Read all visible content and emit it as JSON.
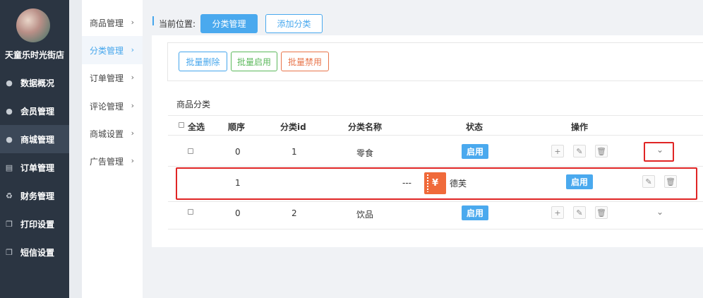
{
  "sidebar": {
    "shop_name": "天童乐时光街店",
    "items": [
      {
        "label": "数据概况",
        "icon": "user-icon"
      },
      {
        "label": "会员管理",
        "icon": "user-icon"
      },
      {
        "label": "商城管理",
        "icon": "user-icon"
      },
      {
        "label": "订单管理",
        "icon": "document-icon"
      },
      {
        "label": "财务管理",
        "icon": "recycle-icon"
      },
      {
        "label": "打印设置",
        "icon": "copy-icon"
      },
      {
        "label": "短信设置",
        "icon": "copy-icon"
      }
    ],
    "active_index": 2
  },
  "subnav": {
    "items": [
      {
        "label": "商品管理"
      },
      {
        "label": "分类管理"
      },
      {
        "label": "订单管理"
      },
      {
        "label": "评论管理"
      },
      {
        "label": "商城设置"
      },
      {
        "label": "广告管理"
      }
    ],
    "active_index": 1
  },
  "breadcrumb": {
    "label": "当前位置:",
    "current": "分类管理",
    "add_button": "添加分类"
  },
  "toolbar": {
    "bulk_delete": "批量删除",
    "bulk_enable": "批量启用",
    "bulk_disable": "批量禁用"
  },
  "table": {
    "title": "商品分类",
    "headers": {
      "select_all": "全选",
      "order": "顺序",
      "id": "分类id",
      "name": "分类名称",
      "status": "状态",
      "actions": "操作"
    },
    "rows": [
      {
        "order": "0",
        "id": "1",
        "name": "零食",
        "status": "启用"
      },
      {
        "order": "1",
        "prefix": "---",
        "name": "德芙",
        "status": "启用"
      },
      {
        "order": "0",
        "id": "2",
        "name": "饮品",
        "status": "启用"
      }
    ]
  },
  "colors": {
    "accent": "#4aa9ee",
    "sidebar_bg": "#2b3542",
    "success": "#5cb85c",
    "danger": "#e8744a",
    "highlight": "#e02525"
  },
  "icons": {
    "thumb_glyph": "¥",
    "add": "+",
    "edit": "✎",
    "delete": "🗑",
    "chevron_right": "›",
    "chevron_down": "⌄"
  }
}
